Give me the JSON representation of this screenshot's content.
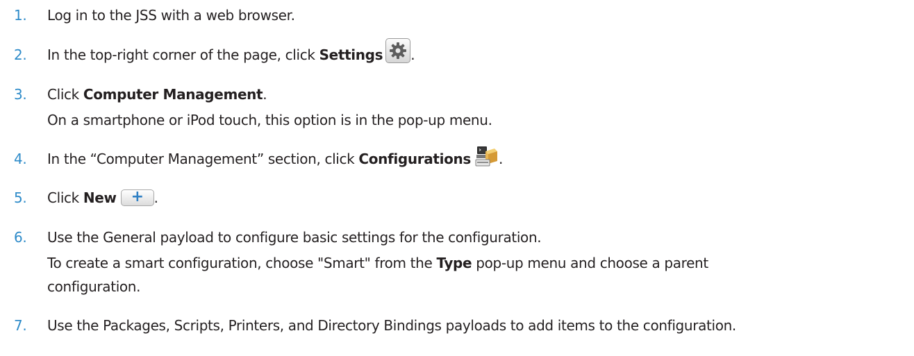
{
  "steps": [
    {
      "num": "1.",
      "text": "Log in to the JSS with a web browser."
    },
    {
      "num": "2.",
      "pre": "In the top-right corner of the page, click ",
      "bold": "Settings",
      "post": ".",
      "icon": "gear-icon"
    },
    {
      "num": "3.",
      "pre": "Click ",
      "bold": "Computer Management",
      "post": ".",
      "continuation": "On a smartphone or iPod touch, this option is in the pop-up menu."
    },
    {
      "num": "4.",
      "pre": "In the “Computer Management” section, click ",
      "bold": "Configurations",
      "post": ".",
      "icon": "configurations-icon"
    },
    {
      "num": "5.",
      "pre": "Click ",
      "bold": "New",
      "post": ".",
      "button_label": "+"
    },
    {
      "num": "6.",
      "text": "Use the General payload to configure basic settings for the configuration.",
      "continuation_pre": "To create a smart configuration, choose \"Smart\" from the ",
      "continuation_bold": "Type",
      "continuation_post": " pop-up menu and choose a parent",
      "continuation_line2": "configuration."
    },
    {
      "num": "7.",
      "text": "Use the Packages, Scripts, Printers, and Directory Bindings payloads to add items to the configuration."
    }
  ],
  "colors": {
    "step_number": "#2e8bc9",
    "text": "#231f20"
  }
}
